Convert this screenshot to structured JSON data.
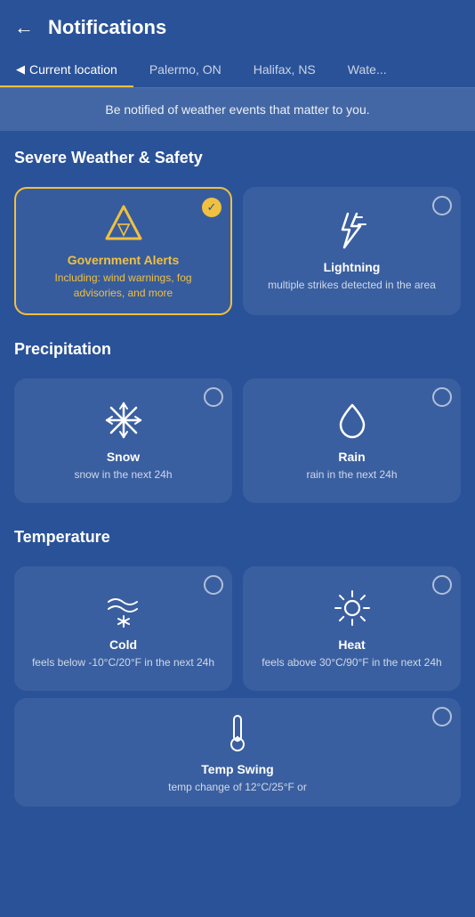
{
  "header": {
    "back_label": "←",
    "title": "Notifications"
  },
  "tabs": [
    {
      "id": "current",
      "label": "Current location",
      "active": true,
      "icon": "▶"
    },
    {
      "id": "palermo",
      "label": "Palermo, ON",
      "active": false
    },
    {
      "id": "halifax",
      "label": "Halifax, NS",
      "active": false
    },
    {
      "id": "water",
      "label": "Wate...",
      "active": false
    }
  ],
  "banner": {
    "text": "Be notified of weather events that matter to you."
  },
  "sections": [
    {
      "id": "severe",
      "title": "Severe Weather & Safety",
      "cards": [
        {
          "id": "gov-alerts",
          "title": "Government Alerts",
          "desc": "Including: wind warnings, fog advisories, and more",
          "selected": true,
          "icon": "gov-alert"
        },
        {
          "id": "lightning",
          "title": "Lightning",
          "desc": "multiple strikes detected in the area",
          "selected": false,
          "icon": "lightning"
        }
      ]
    },
    {
      "id": "precipitation",
      "title": "Precipitation",
      "cards": [
        {
          "id": "snow",
          "title": "Snow",
          "desc": "snow in the next 24h",
          "selected": false,
          "icon": "snow"
        },
        {
          "id": "rain",
          "title": "Rain",
          "desc": "rain in the next 24h",
          "selected": false,
          "icon": "rain"
        }
      ]
    },
    {
      "id": "temperature",
      "title": "Temperature",
      "cards": [
        {
          "id": "cold",
          "title": "Cold",
          "desc": "feels below -10°C/20°F in the next 24h",
          "selected": false,
          "icon": "cold"
        },
        {
          "id": "heat",
          "title": "Heat",
          "desc": "feels above 30°C/90°F in the next 24h",
          "selected": false,
          "icon": "heat"
        }
      ]
    }
  ],
  "bottom_card": {
    "id": "temp-swing",
    "title": "Temp Swing",
    "desc": "temp change of 12°C/25°F or",
    "selected": false,
    "icon": "thermometer"
  }
}
